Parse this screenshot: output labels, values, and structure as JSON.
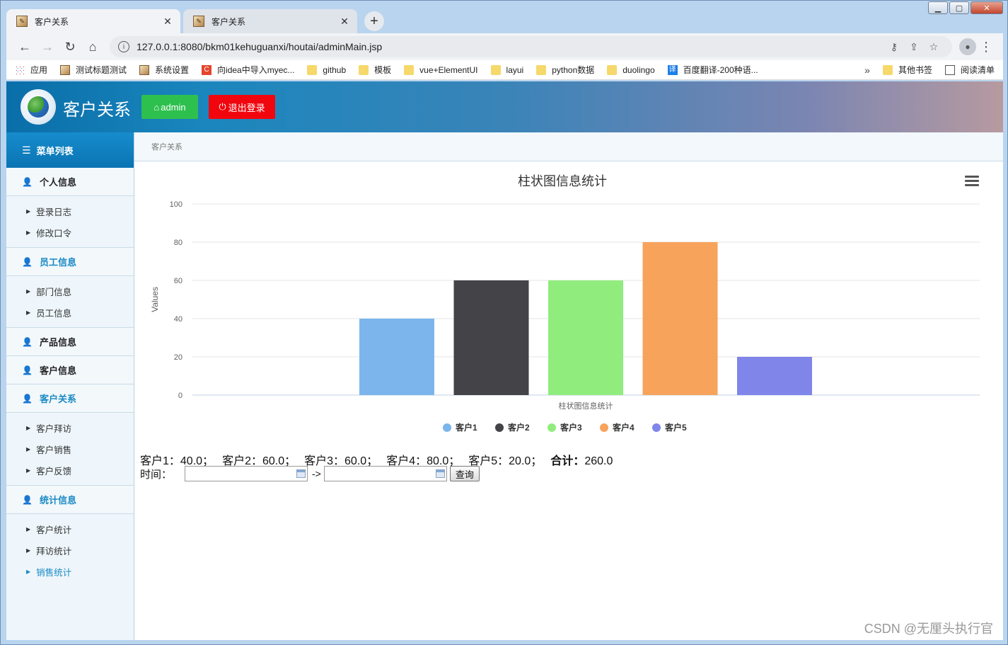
{
  "browser": {
    "tabs": [
      {
        "title": "客户关系",
        "active": true
      },
      {
        "title": "客户关系",
        "active": false
      }
    ],
    "url": "127.0.0.1:8080/bkm01kehuguanxi/houtai/adminMain.jsp",
    "bookmarks": [
      {
        "label": "应用",
        "icon": "apps-icon"
      },
      {
        "label": "测试标题测试",
        "icon": "image-icon"
      },
      {
        "label": "系统设置",
        "icon": "image-icon"
      },
      {
        "label": "向idea中导入myec...",
        "icon": "red-c-icon"
      },
      {
        "label": "github",
        "icon": "folder-icon"
      },
      {
        "label": "模板",
        "icon": "folder-icon"
      },
      {
        "label": "vue+ElementUI",
        "icon": "folder-icon"
      },
      {
        "label": "layui",
        "icon": "folder-icon"
      },
      {
        "label": "python数据",
        "icon": "folder-icon"
      },
      {
        "label": "duolingo",
        "icon": "folder-icon"
      },
      {
        "label": "百度翻译-200种语...",
        "icon": "translate-icon"
      }
    ],
    "bookmarks_more": "»",
    "bookmarks_right": [
      {
        "label": "其他书签",
        "icon": "folder-icon"
      },
      {
        "label": "阅读清单",
        "icon": "reading-list-icon"
      }
    ]
  },
  "header": {
    "title": "客户关系",
    "admin_label": "admin",
    "logout_label": "退出登录"
  },
  "sidebar": {
    "heading": "菜单列表",
    "sections": [
      {
        "label": "个人信息",
        "active": false,
        "items": [
          {
            "label": "登录日志"
          },
          {
            "label": "修改口令"
          }
        ]
      },
      {
        "label": "员工信息",
        "active": true,
        "items": [
          {
            "label": "部门信息"
          },
          {
            "label": "员工信息"
          }
        ]
      },
      {
        "label": "产品信息",
        "active": false,
        "items": []
      },
      {
        "label": "客户信息",
        "active": false,
        "items": []
      },
      {
        "label": "客户关系",
        "active": true,
        "items": [
          {
            "label": "客户拜访"
          },
          {
            "label": "客户销售"
          },
          {
            "label": "客户反馈"
          }
        ]
      },
      {
        "label": "统计信息",
        "active": true,
        "items": [
          {
            "label": "客户统计"
          },
          {
            "label": "拜访统计"
          },
          {
            "label": "销售统计",
            "active": true
          }
        ]
      }
    ]
  },
  "breadcrumb": "客户关系",
  "chart_data": {
    "type": "bar",
    "title": "柱状图信息统计",
    "xlabel": "柱状图信息统计",
    "ylabel": "Values",
    "ylim": [
      0,
      100
    ],
    "yticks": [
      0,
      20,
      40,
      60,
      80,
      100
    ],
    "grid": true,
    "legend_position": "bottom",
    "series": [
      {
        "name": "客户1",
        "value": 40,
        "color": "#7cb5ec"
      },
      {
        "name": "客户2",
        "value": 60,
        "color": "#434348"
      },
      {
        "name": "客户3",
        "value": 60,
        "color": "#90ed7d"
      },
      {
        "name": "客户4",
        "value": 80,
        "color": "#f7a35c"
      },
      {
        "name": "客户5",
        "value": 20,
        "color": "#8085e9"
      }
    ]
  },
  "summary": {
    "items": [
      {
        "label": "客户1：",
        "value": "40.0；"
      },
      {
        "label": "客户2：",
        "value": "60.0；"
      },
      {
        "label": "客户3：",
        "value": "60.0；"
      },
      {
        "label": "客户4：",
        "value": "80.0；"
      },
      {
        "label": "客户5：",
        "value": "20.0；"
      }
    ],
    "total_label": "合计：",
    "total_value": "260.0"
  },
  "query": {
    "time_label": "时间：",
    "start_value": "",
    "end_value": "",
    "arrow": "->",
    "button_label": "查询"
  },
  "watermark": "CSDN @无厘头执行官"
}
